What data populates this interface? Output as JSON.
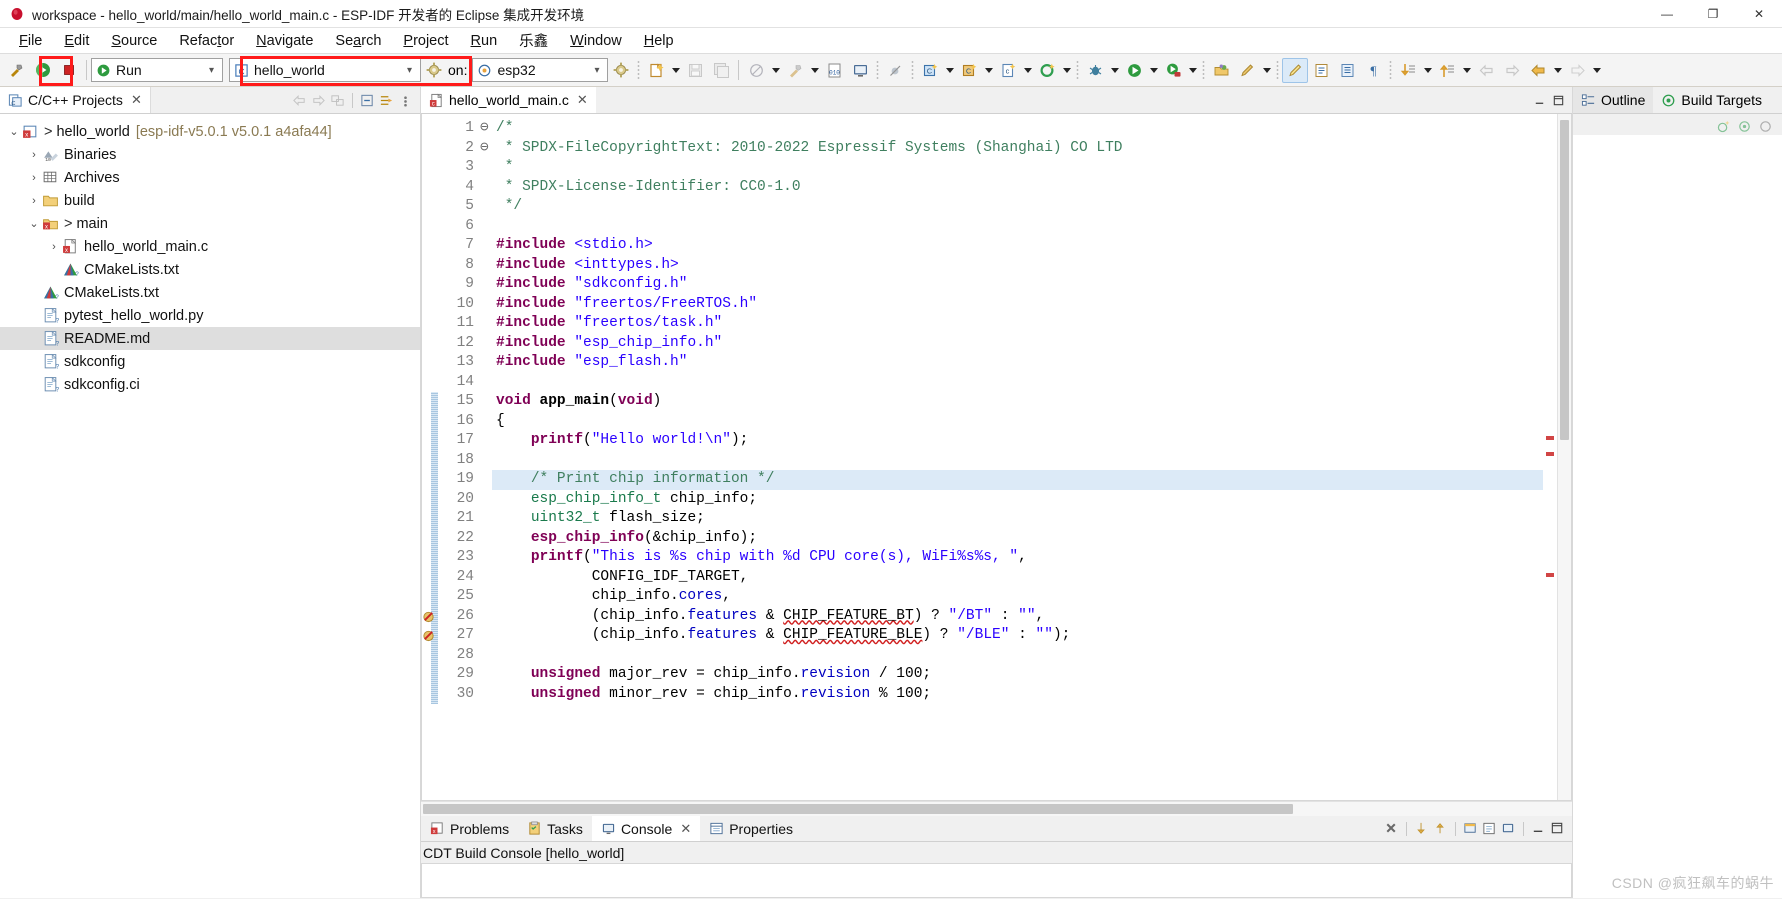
{
  "window": {
    "title": "workspace - hello_world/main/hello_world_main.c - ESP-IDF 开发者的 Eclipse 集成开发环境",
    "app_icon": "eclipse-icon",
    "minimize": "—",
    "maximize": "❐",
    "close": "✕"
  },
  "menubar": [
    {
      "label": "File",
      "mnemonic": "F"
    },
    {
      "label": "Edit",
      "mnemonic": "E"
    },
    {
      "label": "Source",
      "mnemonic": "S"
    },
    {
      "label": "Refactor",
      "mnemonic": "t"
    },
    {
      "label": "Navigate",
      "mnemonic": "N"
    },
    {
      "label": "Search",
      "mnemonic": "a"
    },
    {
      "label": "Project",
      "mnemonic": "P"
    },
    {
      "label": "Run",
      "mnemonic": "R"
    },
    {
      "label": "乐鑫",
      "mnemonic": ""
    },
    {
      "label": "Window",
      "mnemonic": "W"
    },
    {
      "label": "Help",
      "mnemonic": "H"
    }
  ],
  "toolbar": {
    "build_button": "build-hammer-icon",
    "run_button": "run-green-play-icon",
    "stop_button": "stop-red-square-icon",
    "launch_mode": {
      "value": "Run",
      "icon": "run-green-play-icon"
    },
    "launch_target": {
      "value": "hello_world",
      "icon": "c-project-icon",
      "gear": "gear-icon"
    },
    "on_label": "on:",
    "device_target": {
      "value": "esp32",
      "icon": "chip-target-icon"
    },
    "accent_red": "#ff1a1a"
  },
  "projects_view": {
    "tab_label": "C/C++ Projects",
    "close": "✕",
    "tree": [
      {
        "label": "hello_world",
        "suffix": "[esp-idf-v5.0.1 v5.0.1 a4afa44]",
        "indent": 0,
        "twisty": "⌄",
        "arrow": ">",
        "icon": "c-project-icon",
        "selected": false
      },
      {
        "label": "Binaries",
        "suffix": "",
        "indent": 1,
        "twisty": "›",
        "arrow": "",
        "icon": "binaries-icon",
        "selected": false
      },
      {
        "label": "Archives",
        "suffix": "",
        "indent": 1,
        "twisty": "›",
        "arrow": "",
        "icon": "archives-icon",
        "selected": false
      },
      {
        "label": "build",
        "suffix": "",
        "indent": 1,
        "twisty": "›",
        "arrow": "",
        "icon": "folder-icon",
        "selected": false
      },
      {
        "label": "main",
        "suffix": "",
        "indent": 1,
        "twisty": "⌄",
        "arrow": ">",
        "icon": "c-folder-icon",
        "selected": false
      },
      {
        "label": "hello_world_main.c",
        "suffix": "",
        "indent": 2,
        "twisty": "›",
        "arrow": "",
        "icon": "c-source-icon",
        "selected": false
      },
      {
        "label": "CMakeLists.txt",
        "suffix": "",
        "indent": 2,
        "twisty": "",
        "arrow": "",
        "icon": "cmake-icon",
        "selected": false
      },
      {
        "label": "CMakeLists.txt",
        "suffix": "",
        "indent": 1,
        "twisty": "",
        "arrow": "",
        "icon": "cmake-icon",
        "selected": false
      },
      {
        "label": "pytest_hello_world.py",
        "suffix": "",
        "indent": 1,
        "twisty": "",
        "arrow": "",
        "icon": "python-file-icon",
        "selected": false
      },
      {
        "label": "README.md",
        "suffix": "",
        "indent": 1,
        "twisty": "",
        "arrow": "",
        "icon": "text-file-icon",
        "selected": true
      },
      {
        "label": "sdkconfig",
        "suffix": "",
        "indent": 1,
        "twisty": "",
        "arrow": "",
        "icon": "text-file-icon",
        "selected": false
      },
      {
        "label": "sdkconfig.ci",
        "suffix": "",
        "indent": 1,
        "twisty": "",
        "arrow": "",
        "icon": "text-file-icon",
        "selected": false
      }
    ]
  },
  "editor": {
    "tab_label": "hello_world_main.c",
    "tab_icon": "c-source-icon",
    "close": "✕",
    "highlighted_line": 19,
    "error_lines": [
      26,
      27
    ],
    "lines": [
      {
        "n": 1,
        "fold": "⊖",
        "html": "<span class='cmt'>/*</span>"
      },
      {
        "n": 2,
        "fold": "",
        "html": "<span class='cmt'> * SPDX-FileCopyrightText: 2010-2022 Espressif Systems (Shanghai) CO LTD</span>"
      },
      {
        "n": 3,
        "fold": "",
        "html": "<span class='cmt'> *</span>"
      },
      {
        "n": 4,
        "fold": "",
        "html": "<span class='cmt'> * SPDX-License-Identifier: CC0-1.0</span>"
      },
      {
        "n": 5,
        "fold": "",
        "html": "<span class='cmt'> */</span>"
      },
      {
        "n": 6,
        "fold": "",
        "html": ""
      },
      {
        "n": 7,
        "fold": "",
        "html": "<span class='pre'>#include</span> <span class='str'>&lt;stdio.h&gt;</span>"
      },
      {
        "n": 8,
        "fold": "",
        "html": "<span class='pre'>#include</span> <span class='str'>&lt;inttypes.h&gt;</span>"
      },
      {
        "n": 9,
        "fold": "",
        "html": "<span class='pre'>#include</span> <span class='str'>\"sdkconfig.h\"</span>"
      },
      {
        "n": 10,
        "fold": "",
        "html": "<span class='pre'>#include</span> <span class='str'>\"freertos/FreeRTOS.h\"</span>"
      },
      {
        "n": 11,
        "fold": "",
        "html": "<span class='pre'>#include</span> <span class='str'>\"freertos/task.h\"</span>"
      },
      {
        "n": 12,
        "fold": "",
        "html": "<span class='pre'>#include</span> <span class='str'>\"esp_chip_info.h\"</span>"
      },
      {
        "n": 13,
        "fold": "",
        "html": "<span class='pre'>#include</span> <span class='str'>\"esp_flash.h\"</span>"
      },
      {
        "n": 14,
        "fold": "",
        "html": ""
      },
      {
        "n": 15,
        "fold": "⊖",
        "html": "<span class='kw'>void</span> <span class='fn'>app_main</span>(<span class='kw'>void</span>)"
      },
      {
        "n": 16,
        "fold": "",
        "html": "{"
      },
      {
        "n": 17,
        "fold": "",
        "html": "    <span class='call'>printf</span>(<span class='str'>\"Hello world!\\n\"</span>);"
      },
      {
        "n": 18,
        "fold": "",
        "html": ""
      },
      {
        "n": 19,
        "fold": "",
        "html": "    <span class='cmt'>/* Print chip information */</span>"
      },
      {
        "n": 20,
        "fold": "",
        "html": "    <span class='typ'>esp_chip_info_t</span> chip_info;"
      },
      {
        "n": 21,
        "fold": "",
        "html": "    <span class='typ'>uint32_t</span> flash_size;"
      },
      {
        "n": 22,
        "fold": "",
        "html": "    <span class='call'>esp_chip_info</span>(&amp;chip_info);"
      },
      {
        "n": 23,
        "fold": "",
        "html": "    <span class='call'>printf</span>(<span class='str'>\"This is %s chip with %d CPU core(s), WiFi%s%s, \"</span>,"
      },
      {
        "n": 24,
        "fold": "",
        "html": "           CONFIG_IDF_TARGET,"
      },
      {
        "n": 25,
        "fold": "",
        "html": "           chip_info.<span class='fld'>cores</span>,"
      },
      {
        "n": 26,
        "fold": "",
        "html": "           (chip_info.<span class='fld'>features</span> &amp; <span class='err'>CHIP_FEATURE_BT</span>) ? <span class='str'>\"/BT\"</span> : <span class='str'>\"\"</span>,"
      },
      {
        "n": 27,
        "fold": "",
        "html": "           (chip_info.<span class='fld'>features</span> &amp; <span class='err'>CHIP_FEATURE_BLE</span>) ? <span class='str'>\"/BLE\"</span> : <span class='str'>\"\"</span>);"
      },
      {
        "n": 28,
        "fold": "",
        "html": ""
      },
      {
        "n": 29,
        "fold": "",
        "html": "    <span class='kw'>unsigned</span> major_rev = chip_info.<span class='fld'>revision</span> / 100;"
      },
      {
        "n": 30,
        "fold": "",
        "html": "    <span class='kw'>unsigned</span> minor_rev = chip_info.<span class='fld'>revision</span> % 100;"
      }
    ]
  },
  "bottom_panel": {
    "tabs": [
      {
        "label": "Problems",
        "icon": "problems-icon",
        "active": false,
        "closable": false
      },
      {
        "label": "Tasks",
        "icon": "tasks-icon",
        "active": false,
        "closable": false
      },
      {
        "label": "Console",
        "icon": "console-icon",
        "active": true,
        "closable": true
      },
      {
        "label": "Properties",
        "icon": "properties-icon",
        "active": false,
        "closable": false
      }
    ],
    "close": "✕",
    "console_title": "CDT Build Console [hello_world]",
    "tools": [
      "clear-console-icon",
      "scroll-lock-icon",
      "pin-console-icon",
      "display-console-icon",
      "open-console-icon",
      "new-console-icon",
      "minimize-icon",
      "maximize-icon"
    ]
  },
  "right_panel": {
    "tabs": [
      {
        "label": "Outline",
        "icon": "outline-icon",
        "active": true
      },
      {
        "label": "Build Targets",
        "icon": "build-targets-icon",
        "active": false
      }
    ],
    "tools": [
      "add-target-icon",
      "build-target-icon",
      "rebuild-target-icon"
    ]
  },
  "watermark": "CSDN @疯狂飙车的蜗牛"
}
